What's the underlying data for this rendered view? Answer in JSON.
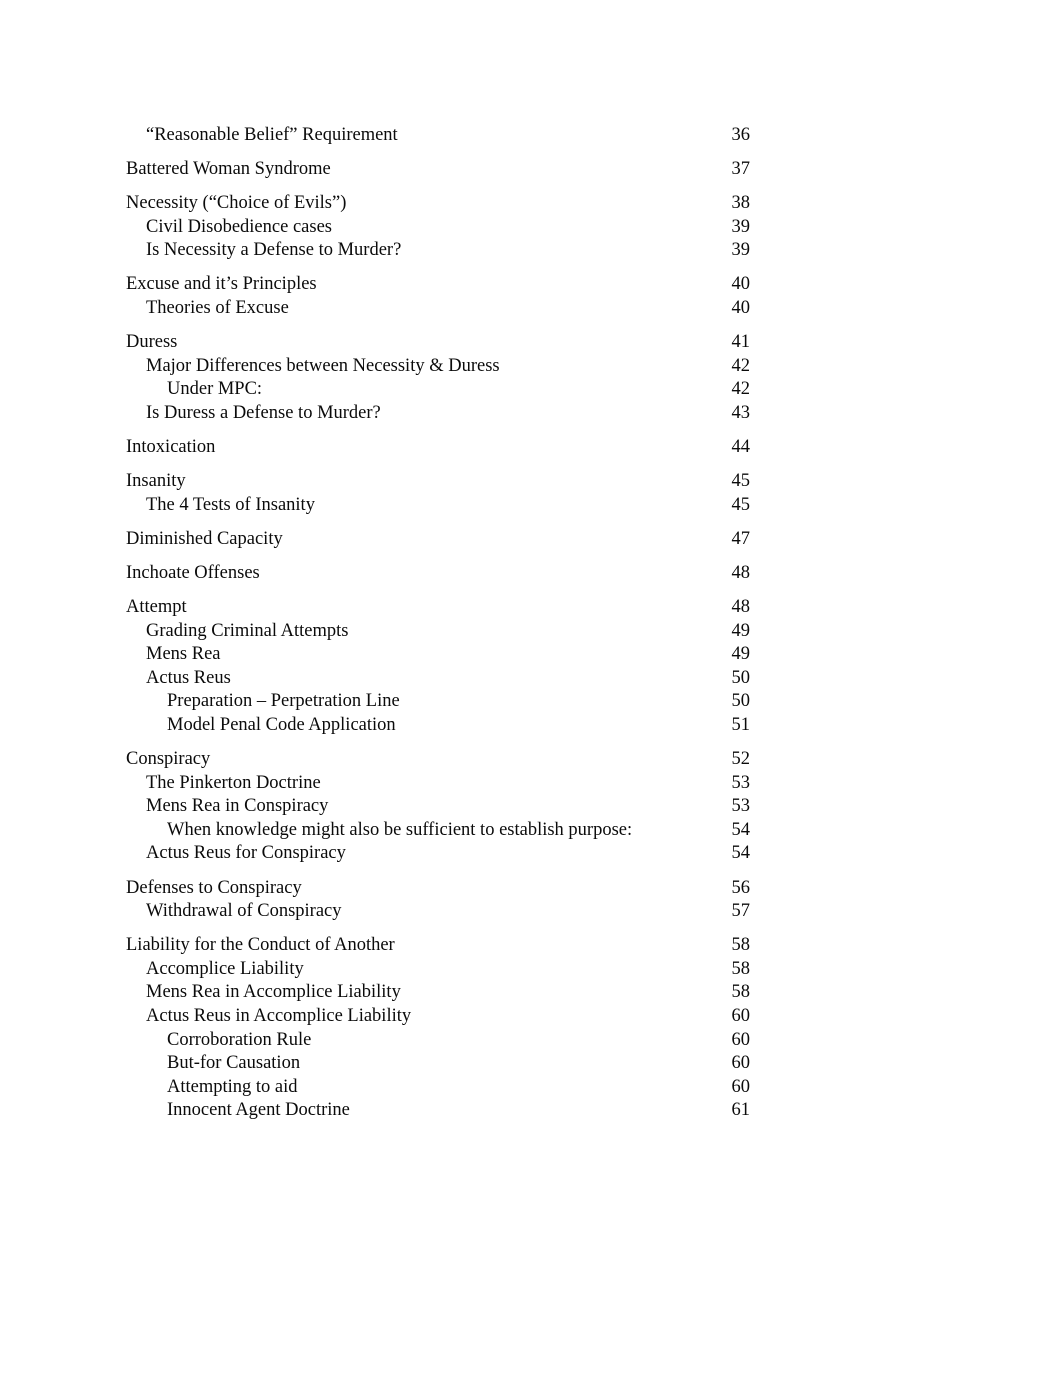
{
  "document": {
    "type": "table-of-contents",
    "page_background": "#ffffff",
    "text_color": "#0b0b0b"
  },
  "toc": {
    "entries": [
      {
        "label": "“Reasonable Belief” Requirement",
        "page": "36",
        "level": 2
      },
      {
        "label": "Battered Woman Syndrome",
        "page": "37",
        "level": 1
      },
      {
        "label": "Necessity (“Choice of Evils”)",
        "page": "38",
        "level": 1
      },
      {
        "label": "Civil Disobedience cases",
        "page": "39",
        "level": 2
      },
      {
        "label": "Is Necessity a Defense to Murder?",
        "page": "39",
        "level": 2
      },
      {
        "label": "Excuse and it’s Principles",
        "page": "40",
        "level": 1
      },
      {
        "label": "Theories of Excuse",
        "page": "40",
        "level": 2
      },
      {
        "label": "Duress",
        "page": "41",
        "level": 1
      },
      {
        "label": "Major Differences between Necessity & Duress",
        "page": "42",
        "level": 2
      },
      {
        "label": "Under MPC:",
        "page": "42",
        "level": 3
      },
      {
        "label": "Is Duress a Defense to Murder?",
        "page": "43",
        "level": 2
      },
      {
        "label": "Intoxication",
        "page": "44",
        "level": 1
      },
      {
        "label": "Insanity",
        "page": "45",
        "level": 1
      },
      {
        "label": "The 4 Tests of Insanity",
        "page": "45",
        "level": 2
      },
      {
        "label": "Diminished Capacity",
        "page": "47",
        "level": 1
      },
      {
        "label": "Inchoate Offenses",
        "page": "48",
        "level": 1
      },
      {
        "label": "Attempt",
        "page": "48",
        "level": 1
      },
      {
        "label": "Grading Criminal Attempts",
        "page": "49",
        "level": 2
      },
      {
        "label": "Mens Rea",
        "page": "49",
        "level": 2
      },
      {
        "label": "Actus Reus",
        "page": "50",
        "level": 2
      },
      {
        "label": "Preparation – Perpetration Line",
        "page": "50",
        "level": 3
      },
      {
        "label": "Model Penal Code Application",
        "page": "51",
        "level": 3
      },
      {
        "label": "Conspiracy",
        "page": "52",
        "level": 1
      },
      {
        "label": "The Pinkerton Doctrine",
        "page": "53",
        "level": 2
      },
      {
        "label": "Mens Rea in Conspiracy",
        "page": "53",
        "level": 2
      },
      {
        "label": "When knowledge might also be sufficient to establish purpose:",
        "page": "54",
        "level": 3
      },
      {
        "label": "Actus Reus for Conspiracy",
        "page": "54",
        "level": 2
      },
      {
        "label": "Defenses to Conspiracy",
        "page": "56",
        "level": 1
      },
      {
        "label": "Withdrawal of Conspiracy",
        "page": "57",
        "level": 2
      },
      {
        "label": "Liability for the Conduct of Another",
        "page": "58",
        "level": 1
      },
      {
        "label": "Accomplice Liability",
        "page": "58",
        "level": 2
      },
      {
        "label": "Mens Rea in Accomplice Liability",
        "page": "58",
        "level": 2
      },
      {
        "label": "Actus Reus in Accomplice Liability",
        "page": "60",
        "level": 2
      },
      {
        "label": "Corroboration Rule",
        "page": "60",
        "level": 3
      },
      {
        "label": "But-for Causation",
        "page": "60",
        "level": 3
      },
      {
        "label": "Attempting to aid",
        "page": "60",
        "level": 3
      },
      {
        "label": "Innocent Agent Doctrine",
        "page": "61",
        "level": 3
      }
    ]
  }
}
